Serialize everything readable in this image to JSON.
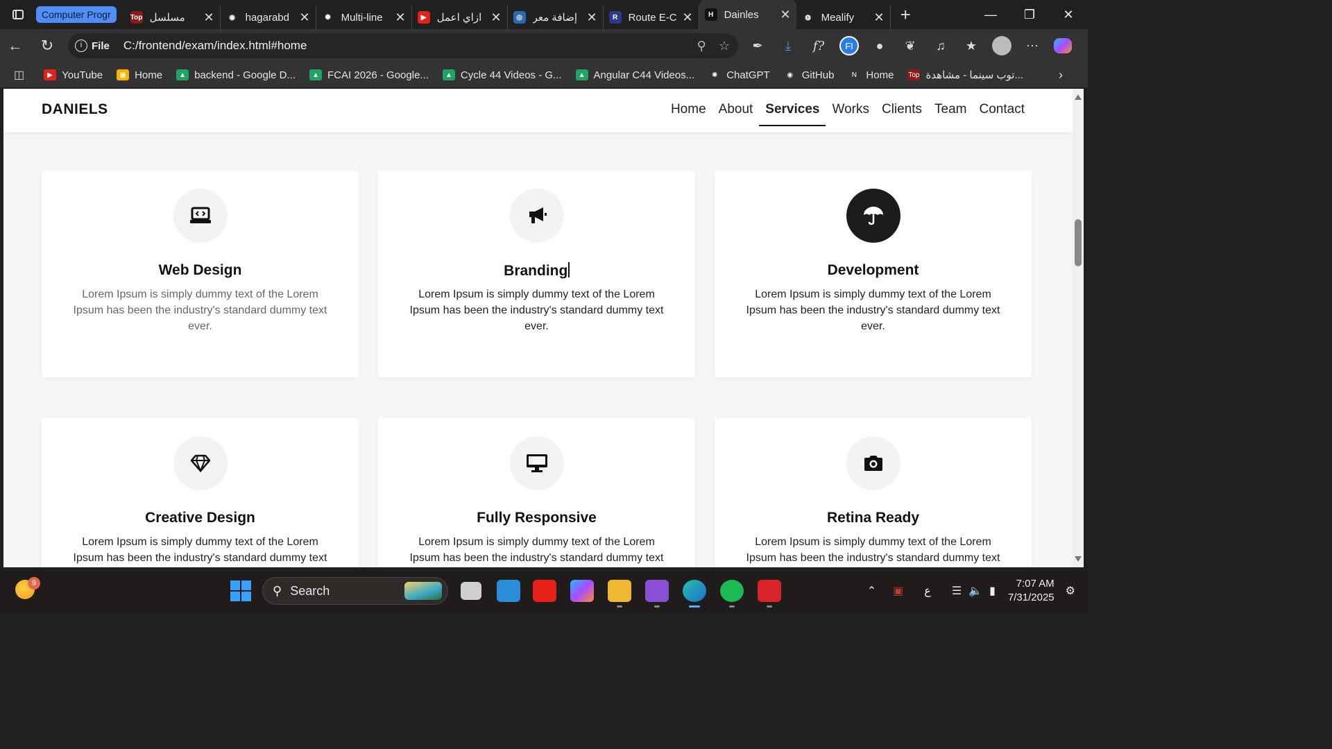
{
  "browser": {
    "group_label": "Computer Progr",
    "tabs": [
      {
        "title": "مسلسل",
        "color": "#8b1a1a",
        "icon": "top-site-icon",
        "glyph": "Top"
      },
      {
        "title": "hagarabd",
        "color": "#222222",
        "icon": "github-icon",
        "glyph": "◉"
      },
      {
        "title": "Multi-line",
        "color": "#222222",
        "icon": "chatgpt-icon",
        "glyph": "✺"
      },
      {
        "title": "ازاي اعمل",
        "color": "#e62117",
        "icon": "youtube-icon",
        "glyph": "▶"
      },
      {
        "title": "إضافة معر",
        "color": "#2a6ab0",
        "icon": "circle-icon",
        "glyph": "◎"
      },
      {
        "title": "Route E-C",
        "color": "#2b3a8c",
        "icon": "route-icon",
        "glyph": "R"
      },
      {
        "title": "Dainles",
        "color": "#111111",
        "icon": "page-icon",
        "glyph": "H",
        "active": true
      },
      {
        "title": "Mealify",
        "color": "#222222",
        "icon": "globe-icon",
        "glyph": "◍"
      }
    ],
    "address": {
      "chip": "File",
      "url": "C:/frontend/exam/index.html#home"
    },
    "bookmarks": [
      {
        "label": "YouTube",
        "color": "#e62117",
        "icon": "youtube-icon",
        "glyph": "▶"
      },
      {
        "label": "Home",
        "color": "#f4b400",
        "icon": "classroom-icon",
        "glyph": "▣"
      },
      {
        "label": "backend - Google D...",
        "color": "#1fa463",
        "icon": "drive-icon",
        "glyph": "▲"
      },
      {
        "label": "FCAI 2026 - Google...",
        "color": "#1fa463",
        "icon": "drive-icon",
        "glyph": "▲"
      },
      {
        "label": "Cycle 44 Videos - G...",
        "color": "#1fa463",
        "icon": "drive-icon",
        "glyph": "▲"
      },
      {
        "label": "Angular C44 Videos...",
        "color": "#1fa463",
        "icon": "drive-icon",
        "glyph": "▲"
      },
      {
        "label": "ChatGPT",
        "color": "#333333",
        "icon": "chatgpt-icon",
        "glyph": "✺"
      },
      {
        "label": "GitHub",
        "color": "#333333",
        "icon": "github-icon",
        "glyph": "◉"
      },
      {
        "label": "Home",
        "color": "#333333",
        "icon": "notion-icon",
        "glyph": "N"
      },
      {
        "label": "توب سينما - مشاهدة...",
        "color": "#8b1a1a",
        "icon": "top-site-icon",
        "glyph": "Top"
      }
    ]
  },
  "site": {
    "brand": "DANIELS",
    "nav": [
      "Home",
      "About",
      "Services",
      "Works",
      "Clients",
      "Team",
      "Contact"
    ],
    "active_nav": "Services",
    "cards": [
      {
        "title": "Web Design",
        "text": "Lorem Ipsum is simply dummy text of the Lorem Ipsum has been the industry's standard dummy text ever.",
        "icon": "laptop-code-icon",
        "muted": true
      },
      {
        "title": "Branding",
        "text": "Lorem Ipsum is simply dummy text of the Lorem Ipsum has been the industry's standard dummy text ever.",
        "icon": "megaphone-icon",
        "caret": true
      },
      {
        "title": "Development",
        "text": "Lorem Ipsum is simply dummy text of the Lorem Ipsum has been the industry's standard dummy text ever.",
        "icon": "umbrella-icon",
        "dark": true
      },
      {
        "title": "Creative Design",
        "text": "Lorem Ipsum is simply dummy text of the Lorem Ipsum has been the industry's standard dummy text ever.",
        "icon": "diamond-icon"
      },
      {
        "title": "Fully Responsive",
        "text": "Lorem Ipsum is simply dummy text of the Lorem Ipsum has been the industry's standard dummy text ever.",
        "icon": "desktop-icon"
      },
      {
        "title": "Retina Ready",
        "text": "Lorem Ipsum is simply dummy text of the Lorem Ipsum has been the industry's standard dummy text ever.",
        "icon": "camera-icon"
      }
    ]
  },
  "taskbar": {
    "weather_badge": "9",
    "search_placeholder": "Search",
    "time": "7:07 AM",
    "date": "7/31/2025",
    "lang": "ع"
  }
}
